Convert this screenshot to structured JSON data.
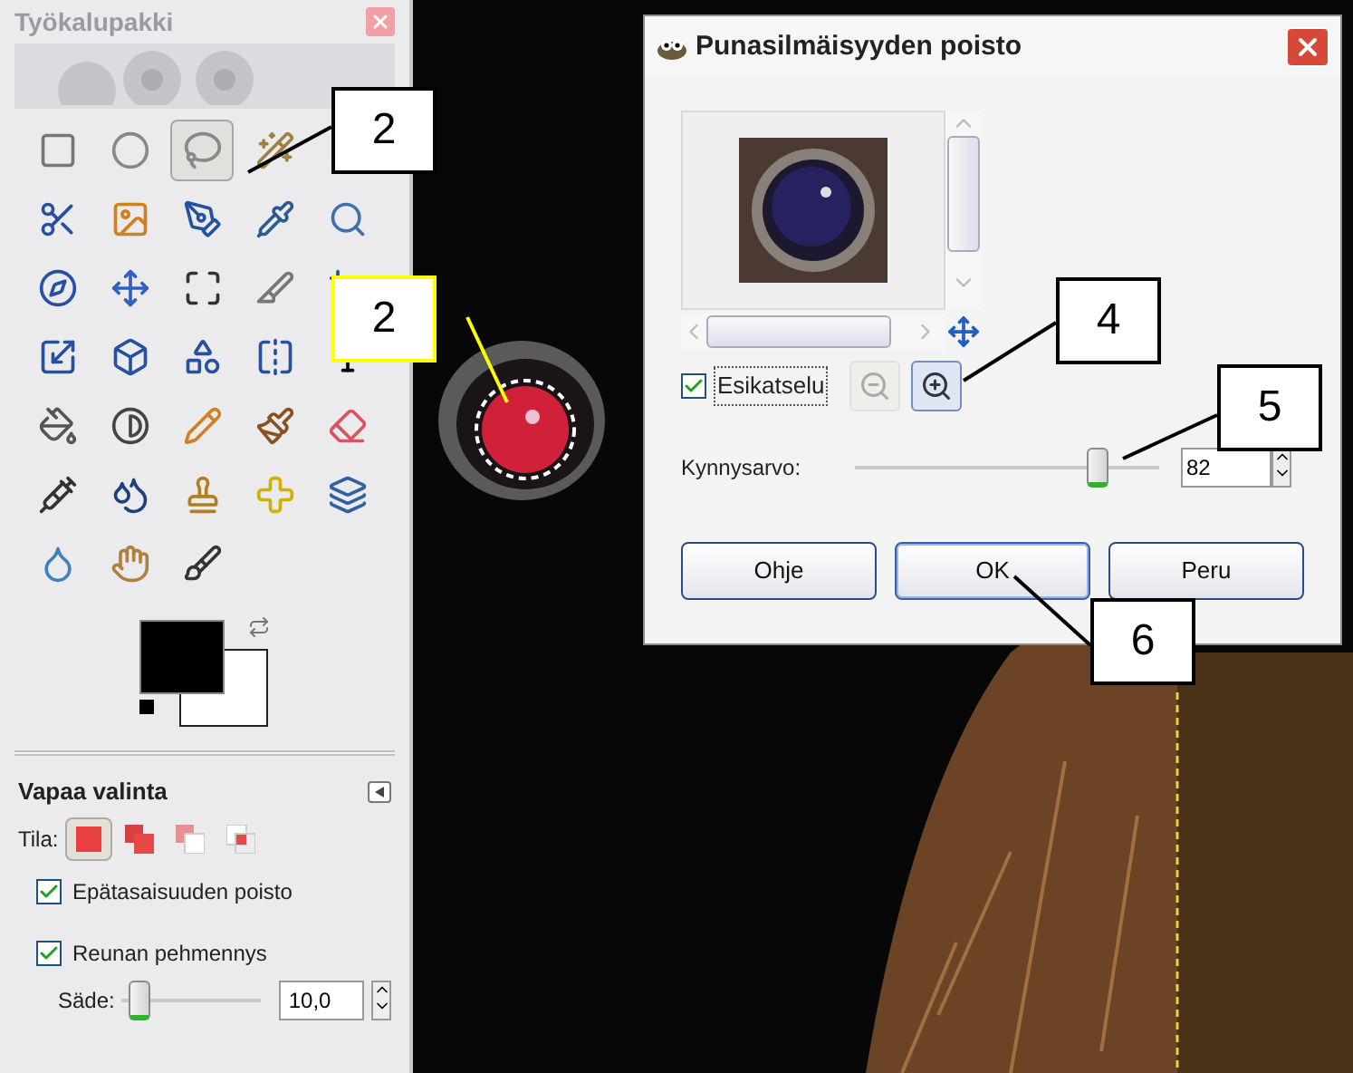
{
  "toolbox": {
    "title": "Työkalupakki",
    "tools": [
      {
        "selected": false
      },
      {
        "selected": false
      },
      {
        "selected": true
      },
      {
        "selected": false
      },
      {
        "selected": false
      },
      {
        "selected": false
      },
      {
        "selected": false
      },
      {
        "selected": false
      },
      {
        "selected": false
      },
      {
        "selected": false
      },
      {
        "selected": false
      },
      {
        "selected": false
      },
      {
        "selected": false
      },
      {
        "selected": false
      },
      {
        "selected": false
      },
      {
        "selected": false
      },
      {
        "selected": false
      },
      {
        "selected": false
      },
      {
        "selected": false
      },
      {
        "selected": false
      },
      {
        "selected": false
      },
      {
        "selected": false
      },
      {
        "selected": false
      },
      {
        "selected": false
      },
      {
        "selected": false
      },
      {
        "selected": false
      },
      {
        "selected": false
      },
      {
        "selected": false
      },
      {
        "selected": false
      },
      {
        "selected": false
      },
      {
        "selected": false
      },
      {
        "selected": false
      },
      {
        "selected": false
      }
    ],
    "tool_options": {
      "title": "Vapaa valinta",
      "mode_label": "Tila:",
      "modes": [
        {
          "selected": true
        },
        {
          "selected": false
        },
        {
          "selected": false
        },
        {
          "selected": false
        }
      ],
      "options": [
        {
          "label": "Epätasaisuuden poisto",
          "checked": true
        },
        {
          "label": "Reunan pehmennys",
          "checked": true
        }
      ],
      "radius": {
        "label": "Säde:",
        "level": 0.12,
        "value": "10,0"
      }
    }
  },
  "dialog": {
    "title": "Punasilmäisyyden poisto",
    "preview": {
      "label": "Esikatselu",
      "checked": true
    },
    "zoom_buttons": [
      {
        "disabled": true
      },
      {
        "disabled": false
      }
    ],
    "threshold": {
      "label": "Kynnysarvo:",
      "level": 0.8,
      "value": "82"
    },
    "buttons": [
      "Ohje",
      "OK",
      "Peru"
    ]
  },
  "callouts": [
    {
      "number": "2",
      "color": "#000000"
    },
    {
      "number": "2",
      "color": "#ffff00"
    },
    {
      "number": "4",
      "color": "#000000"
    },
    {
      "number": "5",
      "color": "#000000"
    },
    {
      "number": "6",
      "color": "#000000"
    }
  ]
}
